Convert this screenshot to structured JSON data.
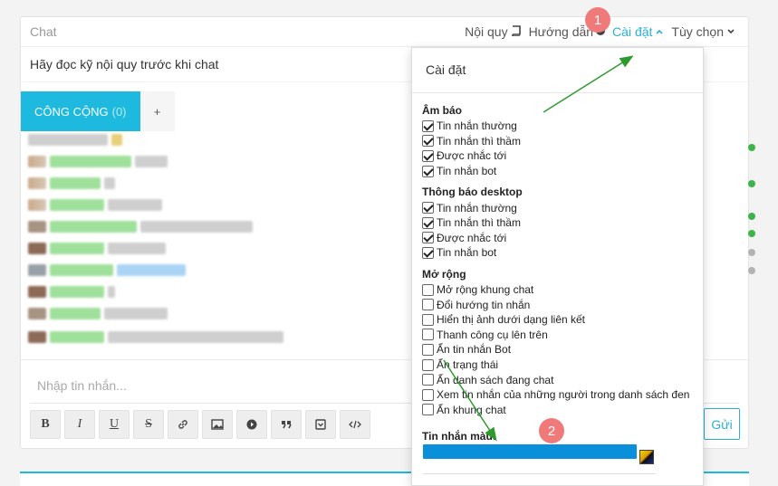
{
  "header": {
    "title": "Chat",
    "links": {
      "rules": "Nội quy",
      "guide": "Hướng dẫn",
      "settings": "Cài đặt",
      "options": "Tùy chọn"
    }
  },
  "notice": "Hãy đọc kỹ nội quy trước khi chat",
  "tabs": {
    "public_label": "CÔNG CỘNG",
    "public_count": "(0)",
    "add_label": "+"
  },
  "composer": {
    "placeholder": "Nhập tin nhắn...",
    "send_label": "Gửi"
  },
  "toolbar": {
    "bold": "B",
    "italic": "I",
    "underline": "U",
    "strike": "S"
  },
  "settings_menu": {
    "title": "Cài đặt",
    "sound": {
      "title": "Âm báo",
      "options": [
        {
          "label": "Tin nhắn thường",
          "checked": true
        },
        {
          "label": "Tin nhắn thì thầm",
          "checked": true
        },
        {
          "label": "Được nhắc tới",
          "checked": true
        },
        {
          "label": "Tin nhắn bot",
          "checked": true
        }
      ]
    },
    "desktop": {
      "title": "Thông báo desktop",
      "options": [
        {
          "label": "Tin nhắn thường",
          "checked": true
        },
        {
          "label": "Tin nhắn thì thầm",
          "checked": true
        },
        {
          "label": "Được nhắc tới",
          "checked": true
        },
        {
          "label": "Tin nhắn bot",
          "checked": true
        }
      ]
    },
    "extend": {
      "title": "Mở rộng",
      "options": [
        {
          "label": "Mở rộng khung chat",
          "checked": false
        },
        {
          "label": "Đổi hướng tin nhắn",
          "checked": false
        },
        {
          "label": "Hiển thị ảnh dưới dạng liên kết",
          "checked": false
        },
        {
          "label": "Thanh công cụ lên trên",
          "checked": false
        },
        {
          "label": "Ẩn tin nhắn Bot",
          "checked": false
        },
        {
          "label": "Ẩn trạng thái",
          "checked": false
        },
        {
          "label": "Ẩn danh sách đang chat",
          "checked": false
        },
        {
          "label": "Xem tin nhắn của những người trong danh sách đen",
          "checked": false
        },
        {
          "label": "Ẩn khung chat",
          "checked": false
        }
      ]
    },
    "color_label": "Tin nhắn màu:",
    "color_value": "#0a8fda"
  },
  "badges": [
    "1",
    "2"
  ],
  "colors": {
    "accent": "#1db9de",
    "badge": "#f07a7a",
    "arrow": "#2e9a2e",
    "online": "#3bb54a",
    "offline": "#b3b3b3"
  },
  "online_status": [
    "online",
    "online",
    "online",
    "online",
    "offline",
    "offline"
  ]
}
